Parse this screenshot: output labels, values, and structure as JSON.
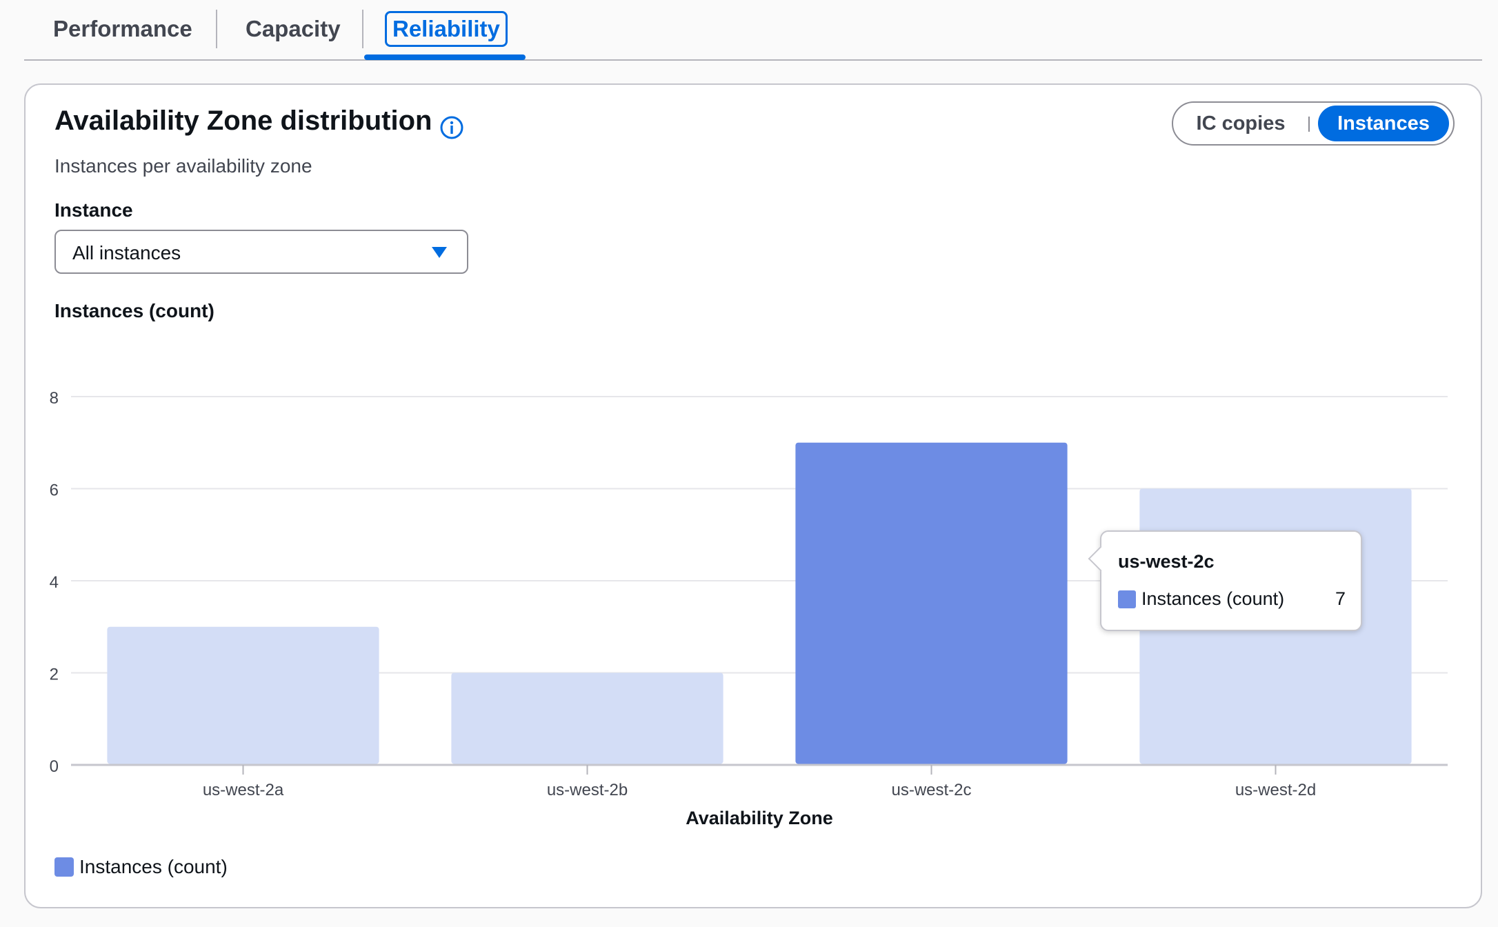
{
  "tabs": [
    {
      "label": "Performance"
    },
    {
      "label": "Capacity"
    },
    {
      "label": "Reliability",
      "active": true
    }
  ],
  "card": {
    "title": "Availability Zone distribution",
    "subtitle": "Instances per availability zone",
    "toggle": {
      "options": [
        "IC copies",
        "Instances"
      ],
      "selected": "Instances"
    },
    "filter": {
      "label": "Instance",
      "value": "All instances"
    },
    "info_icon": "info-circle-icon",
    "caret_icon": "caret-down-icon"
  },
  "colors": {
    "accent": "#006ce0",
    "bar_highlight": "#6d8ce4",
    "bar_muted": "#d3ddf6",
    "grid": "#e6e6ea"
  },
  "chart_data": {
    "type": "bar",
    "title": "Instances (count)",
    "xlabel": "Availability Zone",
    "ylabel": "Instances (count)",
    "categories": [
      "us-west-2a",
      "us-west-2b",
      "us-west-2c",
      "us-west-2d"
    ],
    "series": [
      {
        "name": "Instances (count)",
        "values": [
          3,
          2,
          7,
          6
        ]
      }
    ],
    "highlighted_category": "us-west-2c",
    "ylim": [
      0,
      8
    ],
    "yticks": [
      0,
      2,
      4,
      6,
      8
    ],
    "grid": true,
    "legend": "bottom-left",
    "tooltip": {
      "category": "us-west-2c",
      "series": "Instances (count)",
      "value": 7
    }
  }
}
